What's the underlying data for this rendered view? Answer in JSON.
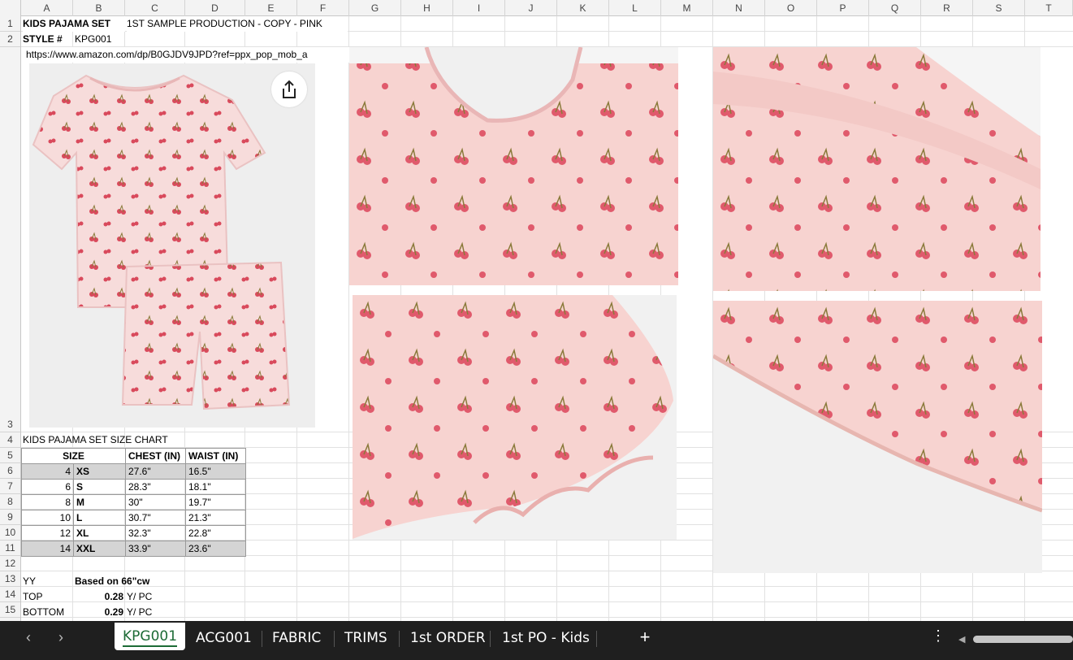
{
  "columns": [
    "A",
    "B",
    "C",
    "D",
    "E",
    "F",
    "G",
    "H",
    "I",
    "J",
    "K",
    "L",
    "M",
    "N",
    "O",
    "P",
    "Q",
    "R",
    "S",
    "T"
  ],
  "rows": [
    "1",
    "2",
    "3",
    "4",
    "5",
    "6",
    "7",
    "8",
    "9",
    "10",
    "11",
    "12",
    "13",
    "14",
    "15"
  ],
  "cells": {
    "A1": "KIDS PAJAMA SET",
    "C1": "1ST SAMPLE PRODUCTION - COPY - PINK",
    "A2": "STYLE #",
    "B2": "KPG001",
    "url": "https://www.amazon.com/dp/B0GJDV9JPD?ref=ppx_pop_mob_a",
    "A4": "KIDS PAJAMA SET SIZE CHART",
    "A13": "YY",
    "B13": "Based on 66\"cw",
    "A14": "TOP",
    "B14": "0.28",
    "C14": "Y/ PC",
    "A15": "BOTTOM",
    "B15": "0.29",
    "C15": "Y/ PC"
  },
  "size_chart": {
    "headers": [
      "SIZE",
      "CHEST (IN)",
      "WAIST (IN)"
    ],
    "rows": [
      {
        "num": "4",
        "size": "XS",
        "chest": "27.6\"",
        "waist": "16.5\""
      },
      {
        "num": "6",
        "size": "S",
        "chest": "28.3\"",
        "waist": "18.1\""
      },
      {
        "num": "8",
        "size": "M",
        "chest": "30\"",
        "waist": "19.7\""
      },
      {
        "num": "10",
        "size": "L",
        "chest": "30.7\"",
        "waist": "21.3\""
      },
      {
        "num": "12",
        "size": "XL",
        "chest": "32.3\"",
        "waist": "22.8\""
      },
      {
        "num": "14",
        "size": "XXL",
        "chest": "33.9\"",
        "waist": "23.6\""
      }
    ]
  },
  "images": {
    "main_icon": "share-icon",
    "colors": {
      "fabric": "#f5cfcc",
      "cherry": "#d94a5c",
      "stem": "#8a7a3a",
      "background": "#eeeeee"
    }
  },
  "tabs": {
    "items": [
      "KPG001",
      "ACG001",
      "FABRIC",
      "TRIMS",
      "1st ORDER",
      "1st PO - Kids"
    ],
    "active": "KPG001",
    "prev_icon": "chevron-left-icon",
    "next_icon": "chevron-right-icon",
    "add_icon": "plus-icon",
    "more_icon": "more-vertical-icon"
  }
}
